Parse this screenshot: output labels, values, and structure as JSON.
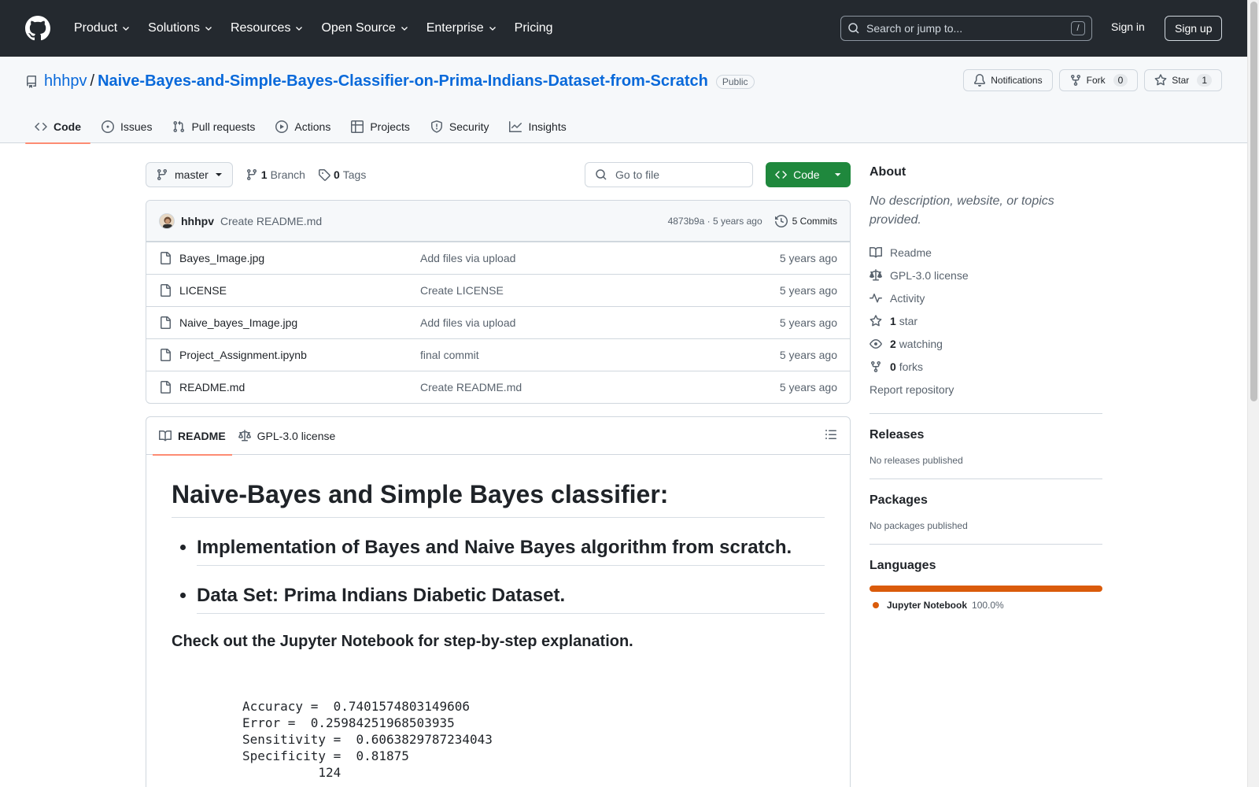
{
  "header": {
    "nav": [
      "Product",
      "Solutions",
      "Resources",
      "Open Source",
      "Enterprise",
      "Pricing"
    ],
    "search_placeholder": "Search or jump to...",
    "search_key": "/",
    "sign_in": "Sign in",
    "sign_up": "Sign up"
  },
  "repo": {
    "owner": "hhhpv",
    "separator": "/",
    "name": "Naive-Bayes-and-Simple-Bayes-Classifier-on-Prima-Indians-Dataset-from-Scratch",
    "visibility": "Public",
    "notifications_label": "Notifications",
    "fork_label": "Fork",
    "fork_count": "0",
    "star_label": "Star",
    "star_count": "1",
    "tabs": [
      "Code",
      "Issues",
      "Pull requests",
      "Actions",
      "Projects",
      "Security",
      "Insights"
    ]
  },
  "filebar": {
    "branch": "master",
    "branch_count": "1",
    "branch_label": "Branch",
    "tag_count": "0",
    "tag_label": "Tags",
    "goto_placeholder": "Go to file",
    "code_label": "Code"
  },
  "commit": {
    "author": "hhhpv",
    "message": "Create README.md",
    "meta": "4873b9a · 5 years ago",
    "commits_label": "5 Commits"
  },
  "files": [
    {
      "name": "Bayes_Image.jpg",
      "message": "Add files via upload",
      "age": "5 years ago"
    },
    {
      "name": "LICENSE",
      "message": "Create LICENSE",
      "age": "5 years ago"
    },
    {
      "name": "Naive_bayes_Image.jpg",
      "message": "Add files via upload",
      "age": "5 years ago"
    },
    {
      "name": "Project_Assignment.ipynb",
      "message": "final commit",
      "age": "5 years ago"
    },
    {
      "name": "README.md",
      "message": "Create README.md",
      "age": "5 years ago"
    }
  ],
  "readme": {
    "tab_readme": "README",
    "tab_license": "GPL-3.0 license",
    "title": "Naive-Bayes and Simple Bayes classifier:",
    "bullets": [
      "Implementation of Bayes and Naive Bayes algorithm from scratch.",
      "Data Set: Prima Indians Diabetic Dataset."
    ],
    "subheading": "Check out the Jupyter Notebook for step-by-step explanation.",
    "code_lines": [
      "Accuracy =  0.7401574803149606",
      "Error =  0.25984251968503935",
      "Sensitivity =  0.6063829787234043",
      "Specificity =  0.81875",
      "          124"
    ]
  },
  "sidebar": {
    "about_title": "About",
    "about_desc": "No description, website, or topics provided.",
    "readme": "Readme",
    "license": "GPL-3.0 license",
    "activity": "Activity",
    "stars_count": "1",
    "stars_label": "star",
    "watching_count": "2",
    "watching_label": "watching",
    "forks_count": "0",
    "forks_label": "forks",
    "report": "Report repository",
    "releases_title": "Releases",
    "releases_desc": "No releases published",
    "packages_title": "Packages",
    "packages_desc": "No packages published",
    "languages_title": "Languages",
    "language_name": "Jupyter Notebook",
    "language_pct": "100.0%",
    "language_fraction": 1.0,
    "language_color": "#DA5B0B"
  },
  "colors": {
    "header_bg": "#24292f",
    "link": "#0969da",
    "code_button": "#1f883d",
    "tab_underline": "#fd8c73"
  }
}
